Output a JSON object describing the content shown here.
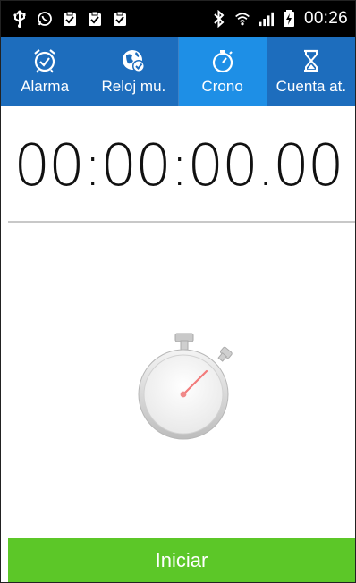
{
  "status_bar": {
    "time": "00:26",
    "icons": [
      "usb-icon",
      "whatsapp-icon",
      "clipboard-check-icon",
      "clipboard-check-icon",
      "clipboard-check-icon",
      "bluetooth-icon",
      "wifi-icon",
      "signal-icon",
      "battery-charging-icon"
    ]
  },
  "tabs": [
    {
      "label": "Alarma",
      "icon": "alarm-clock-icon",
      "active": false
    },
    {
      "label": "Reloj mu.",
      "icon": "world-clock-icon",
      "active": false
    },
    {
      "label": "Crono",
      "icon": "stopwatch-icon",
      "active": true
    },
    {
      "label": "Cuenta at.",
      "icon": "hourglass-icon",
      "active": false
    }
  ],
  "timer": {
    "display": "00:00:00.00"
  },
  "start_button": {
    "label": "Iniciar"
  },
  "colors": {
    "tab_bar": "#1d6dbd",
    "active_tab": "#1e8fe6",
    "start": "#5cc728",
    "status_bar": "#000000"
  }
}
